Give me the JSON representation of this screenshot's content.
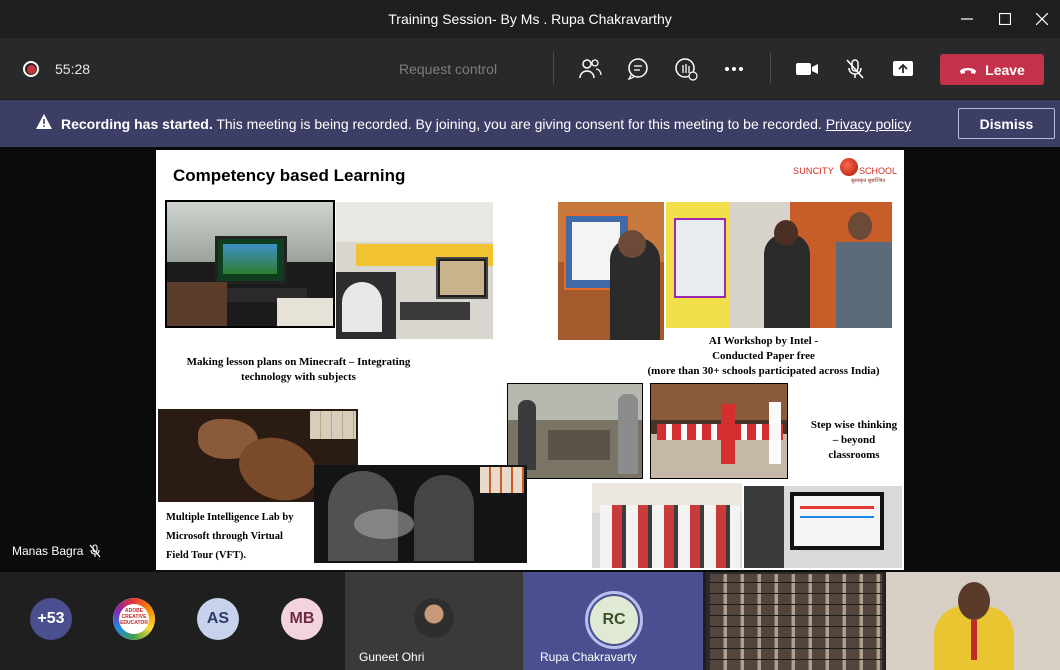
{
  "window": {
    "title": "Training Session- By Ms . Rupa Chakravarthy"
  },
  "controls": {
    "timer": "55:28",
    "request_control": "Request control",
    "leave_label": "Leave"
  },
  "banner": {
    "bold": "Recording has started.",
    "message": " This meeting is being recorded. By joining, you are giving consent for this meeting to be recorded. ",
    "link": "Privacy policy",
    "dismiss": "Dismiss"
  },
  "presenter_label": "Manas Bagra",
  "slide": {
    "title": "Competency based Learning",
    "logo_left": "SUNCITY",
    "logo_right": "SCHOOL",
    "logo_tag": "सुसंस्कृत सुसज्जित",
    "caption_minecraft": "Making lesson plans on Minecraft – Integrating technology with subjects",
    "caption_ai_1": "AI Workshop by Intel -",
    "caption_ai_2": "Conducted Paper free",
    "caption_ai_3": "(more than 30+ schools participated across India)",
    "caption_step_1": "Step wise thinking",
    "caption_step_2": "– beyond",
    "caption_step_3": "classrooms",
    "caption_mi_1": "Multiple Intelligence Lab by",
    "caption_mi_2": "Microsoft through Virtual",
    "caption_mi_3": "Field Tour (VFT).",
    "badge_text_1": "ADOBE",
    "badge_text_2": "CREATIVE",
    "badge_text_3": "EDUCATOR"
  },
  "participants": {
    "overflow": "+53",
    "avatars": [
      "AS",
      "MB"
    ],
    "guneet": "Guneet Ohri",
    "rupa_initials": "RC",
    "rupa": "Rupa Chakravarty"
  }
}
